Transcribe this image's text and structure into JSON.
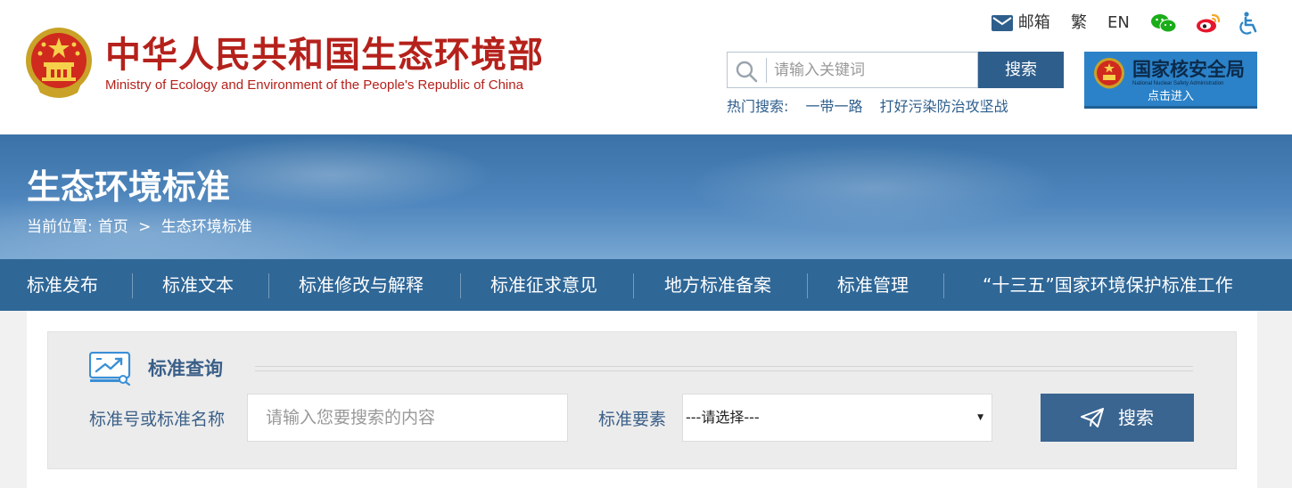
{
  "header": {
    "title_cn": "中华人民共和国生态环境部",
    "title_en": "Ministry of Ecology and Environment of the People's Republic of China",
    "top_links": {
      "mail": "邮箱",
      "traditional": "繁",
      "english": "EN"
    },
    "search": {
      "placeholder": "请输入关键词",
      "button": "搜索"
    },
    "hot_search": {
      "label": "热门搜索:",
      "items": [
        "一带一路",
        "打好污染防治攻坚战"
      ]
    },
    "nnsa_banner": {
      "title": "国家核安全局",
      "subtitle": "National Nuclear Safety Administration",
      "enter": "点击进入"
    }
  },
  "banner": {
    "title": "生态环境标准",
    "breadcrumb": {
      "label": "当前位置:",
      "home": "首页",
      "separator": ">",
      "current": "生态环境标准"
    }
  },
  "nav": {
    "items": [
      "标准发布",
      "标准文本",
      "标准修改与解释",
      "标准征求意见",
      "地方标准备案",
      "标准管理",
      "“十三五”国家环境保护标准工作"
    ]
  },
  "query": {
    "title": "标准查询",
    "field1_label": "标准号或标准名称",
    "field1_placeholder": "请输入您要搜索的内容",
    "field2_label": "标准要素",
    "field2_value": "---请选择---",
    "button": "搜索"
  },
  "colors": {
    "brand_red": "#b5211b",
    "nav_blue": "#2f6797",
    "button_blue": "#2e5e8c",
    "query_blue": "#3a6591"
  },
  "icons": [
    "mail-icon",
    "wechat-icon",
    "weibo-icon",
    "accessibility-icon",
    "search-icon",
    "national-emblem-icon",
    "query-chart-icon",
    "paper-plane-icon"
  ]
}
